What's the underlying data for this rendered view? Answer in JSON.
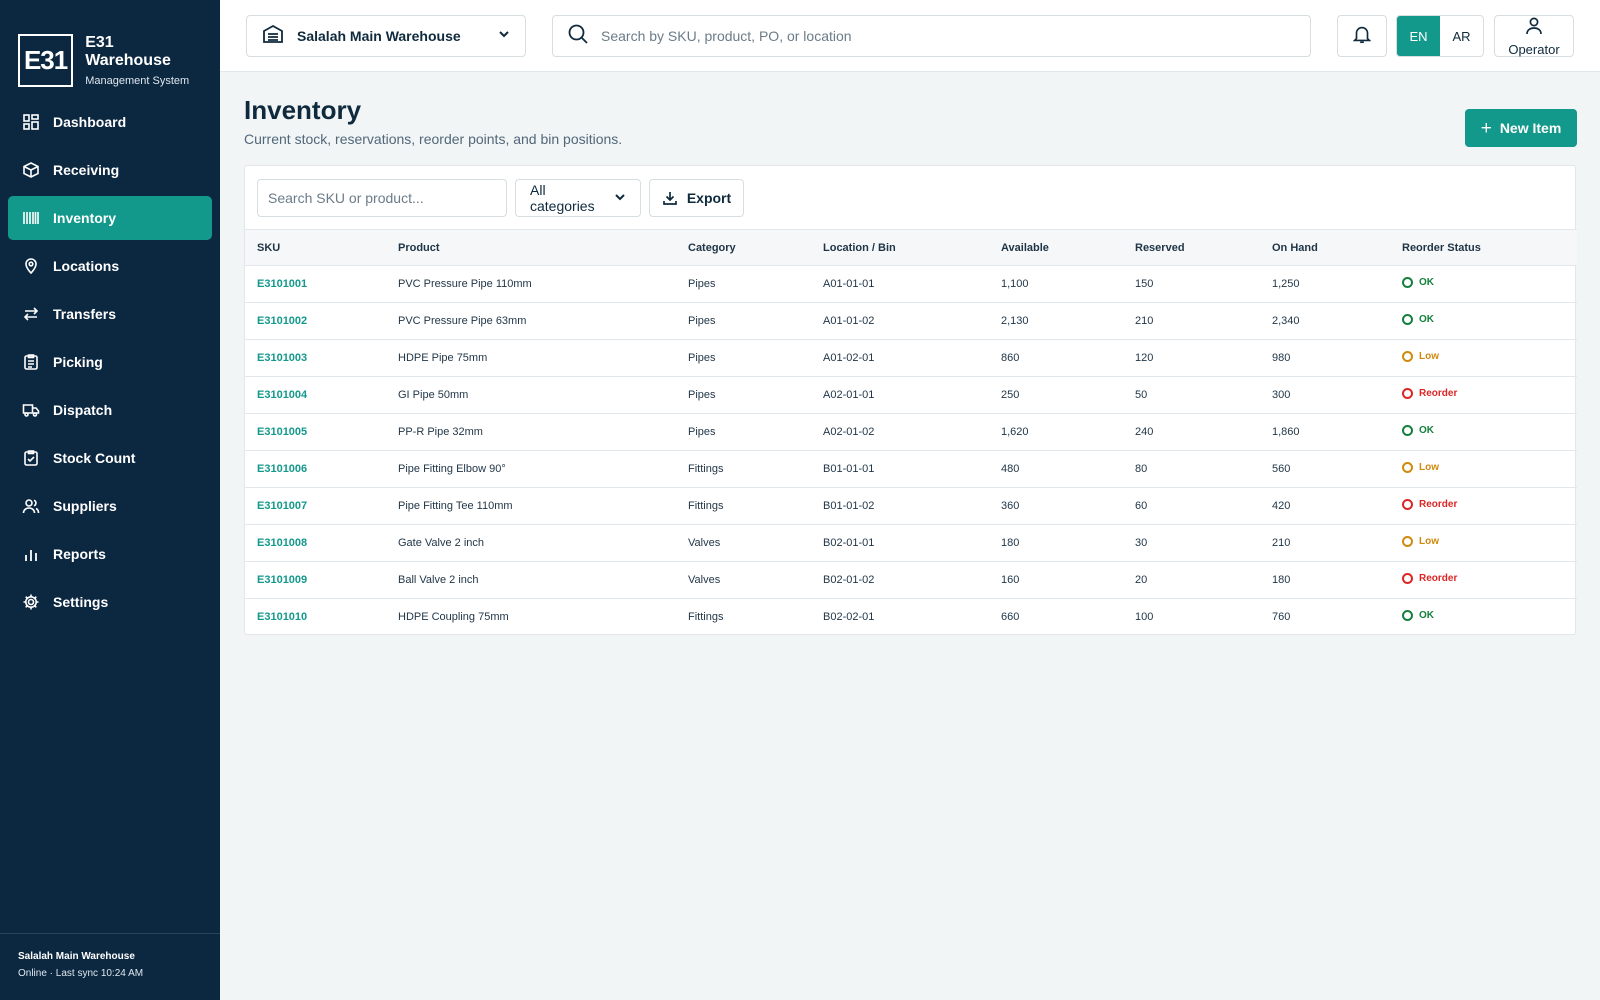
{
  "brand": {
    "logo": "E31",
    "title": "E31 Warehouse",
    "subtitle": "Management System"
  },
  "sidebar": {
    "items": [
      {
        "label": "Dashboard",
        "icon": "dashboard-icon",
        "active": false
      },
      {
        "label": "Receiving",
        "icon": "box-icon",
        "active": false
      },
      {
        "label": "Inventory",
        "icon": "barcode-icon",
        "active": true
      },
      {
        "label": "Locations",
        "icon": "map-pin-icon",
        "active": false
      },
      {
        "label": "Transfers",
        "icon": "arrows-swap-icon",
        "active": false
      },
      {
        "label": "Picking",
        "icon": "clipboard-list-icon",
        "active": false
      },
      {
        "label": "Dispatch",
        "icon": "truck-icon",
        "active": false
      },
      {
        "label": "Stock Count",
        "icon": "clipboard-check-icon",
        "active": false
      },
      {
        "label": "Suppliers",
        "icon": "users-icon",
        "active": false
      },
      {
        "label": "Reports",
        "icon": "bar-chart-icon",
        "active": false
      },
      {
        "label": "Settings",
        "icon": "gear-icon",
        "active": false
      }
    ],
    "footer": {
      "warehouse": "Salalah Main Warehouse",
      "status": "Online · Last sync 10:24 AM"
    }
  },
  "topbar": {
    "warehouse": "Salalah Main Warehouse",
    "search_placeholder": "Search by SKU, product, PO, or location",
    "lang_en": "EN",
    "lang_ar": "AR",
    "user_label": "Operator"
  },
  "page": {
    "title": "Inventory",
    "subtitle": "Current stock, reservations, reorder points, and bin positions.",
    "new_button": "New Item"
  },
  "filters": {
    "search_placeholder": "Search SKU or product...",
    "category": "All categories",
    "export": "Export"
  },
  "table": {
    "columns": [
      "SKU",
      "Product",
      "Category",
      "Location / Bin",
      "Available",
      "Reserved",
      "On Hand",
      "Reorder Status"
    ],
    "rows": [
      [
        "E3101001",
        "PVC Pressure Pipe 110mm",
        "Pipes",
        "A01-01-01",
        "1,100",
        "150",
        "1,250",
        "OK"
      ],
      [
        "E3101002",
        "PVC Pressure Pipe 63mm",
        "Pipes",
        "A01-01-02",
        "2,130",
        "210",
        "2,340",
        "OK"
      ],
      [
        "E3101003",
        "HDPE Pipe 75mm",
        "Pipes",
        "A01-02-01",
        "860",
        "120",
        "980",
        "Low"
      ],
      [
        "E3101004",
        "GI Pipe 50mm",
        "Pipes",
        "A02-01-01",
        "250",
        "50",
        "300",
        "Reorder"
      ],
      [
        "E3101005",
        "PP-R Pipe 32mm",
        "Pipes",
        "A02-01-02",
        "1,620",
        "240",
        "1,860",
        "OK"
      ],
      [
        "E3101006",
        "Pipe Fitting Elbow 90°",
        "Fittings",
        "B01-01-01",
        "480",
        "80",
        "560",
        "Low"
      ],
      [
        "E3101007",
        "Pipe Fitting Tee 110mm",
        "Fittings",
        "B01-01-02",
        "360",
        "60",
        "420",
        "Reorder"
      ],
      [
        "E3101008",
        "Gate Valve 2 inch",
        "Valves",
        "B02-01-01",
        "180",
        "30",
        "210",
        "Low"
      ],
      [
        "E3101009",
        "Ball Valve 2 inch",
        "Valves",
        "B02-01-02",
        "160",
        "20",
        "180",
        "Reorder"
      ],
      [
        "E3101010",
        "HDPE Coupling 75mm",
        "Fittings",
        "B02-02-01",
        "660",
        "100",
        "760",
        "OK"
      ]
    ]
  },
  "colors": {
    "sidebar_bg": "#0c2740",
    "accent": "#13998b",
    "status_ok": "#15803d",
    "status_low": "#d08a0e",
    "status_reorder": "#dc2626"
  }
}
